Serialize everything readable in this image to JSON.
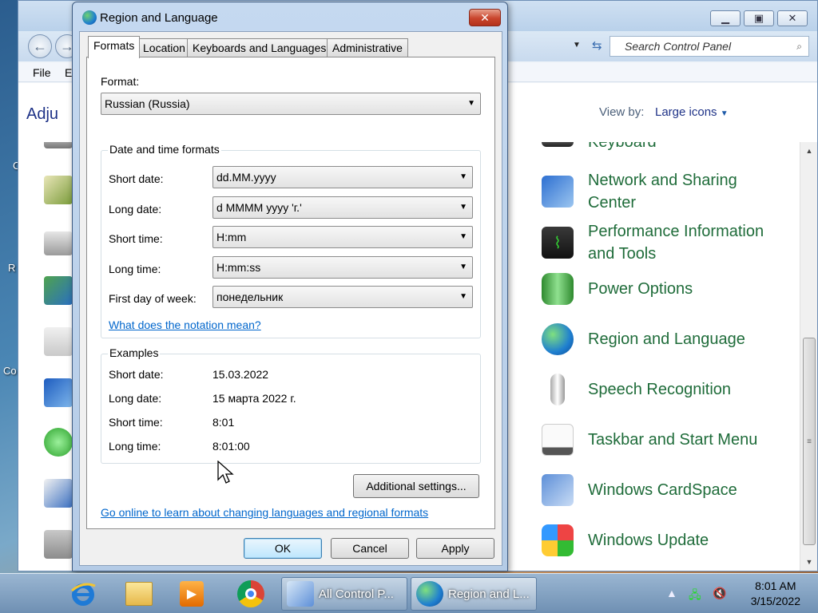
{
  "desktop": {
    "labels": [
      "C",
      "R",
      "Co"
    ]
  },
  "control_panel": {
    "menu": [
      "File",
      "E"
    ],
    "heading": "Adju",
    "search_placeholder": "Search Control Panel",
    "view_by_label": "View by:",
    "view_by_value": "Large icons",
    "items": [
      {
        "label": "Keyboard",
        "icon": "keyboard-icon"
      },
      {
        "label": "Network and Sharing Center",
        "icon": "network-icon"
      },
      {
        "label": "Performance Information and Tools",
        "icon": "performance-icon"
      },
      {
        "label": "Power Options",
        "icon": "battery-icon"
      },
      {
        "label": "Region and Language",
        "icon": "globe-clock-icon"
      },
      {
        "label": "Speech Recognition",
        "icon": "microphone-icon"
      },
      {
        "label": "Taskbar and Start Menu",
        "icon": "taskbar-icon"
      },
      {
        "label": "Windows CardSpace",
        "icon": "cardspace-icon"
      },
      {
        "label": "Windows Update",
        "icon": "windows-update-icon"
      }
    ]
  },
  "dialog": {
    "title": "Region and Language",
    "close_label": "✕",
    "tabs": [
      "Formats",
      "Location",
      "Keyboards and Languages",
      "Administrative"
    ],
    "format_label": "Format:",
    "format_value": "Russian (Russia)",
    "datetime_group": "Date and time formats",
    "fields": [
      {
        "label": "Short date:",
        "value": "dd.MM.yyyy"
      },
      {
        "label": "Long date:",
        "value": "d MMMM yyyy 'г.'"
      },
      {
        "label": "Short time:",
        "value": "H:mm"
      },
      {
        "label": "Long time:",
        "value": "H:mm:ss"
      },
      {
        "label": "First day of week:",
        "value": "понедельник"
      }
    ],
    "notation_link": "What does the notation mean?",
    "examples_group": "Examples",
    "examples": [
      {
        "label": "Short date:",
        "value": "15.03.2022"
      },
      {
        "label": "Long date:",
        "value": "15 марта 2022 г."
      },
      {
        "label": "Short time:",
        "value": "8:01"
      },
      {
        "label": "Long time:",
        "value": "8:01:00"
      }
    ],
    "additional_button": "Additional settings...",
    "online_link": "Go online to learn about changing languages and regional formats",
    "ok": "OK",
    "cancel": "Cancel",
    "apply": "Apply"
  },
  "taskbar": {
    "tasks": [
      "All Control P...",
      "Region and L..."
    ],
    "time": "8:01 AM",
    "date": "3/15/2022"
  }
}
